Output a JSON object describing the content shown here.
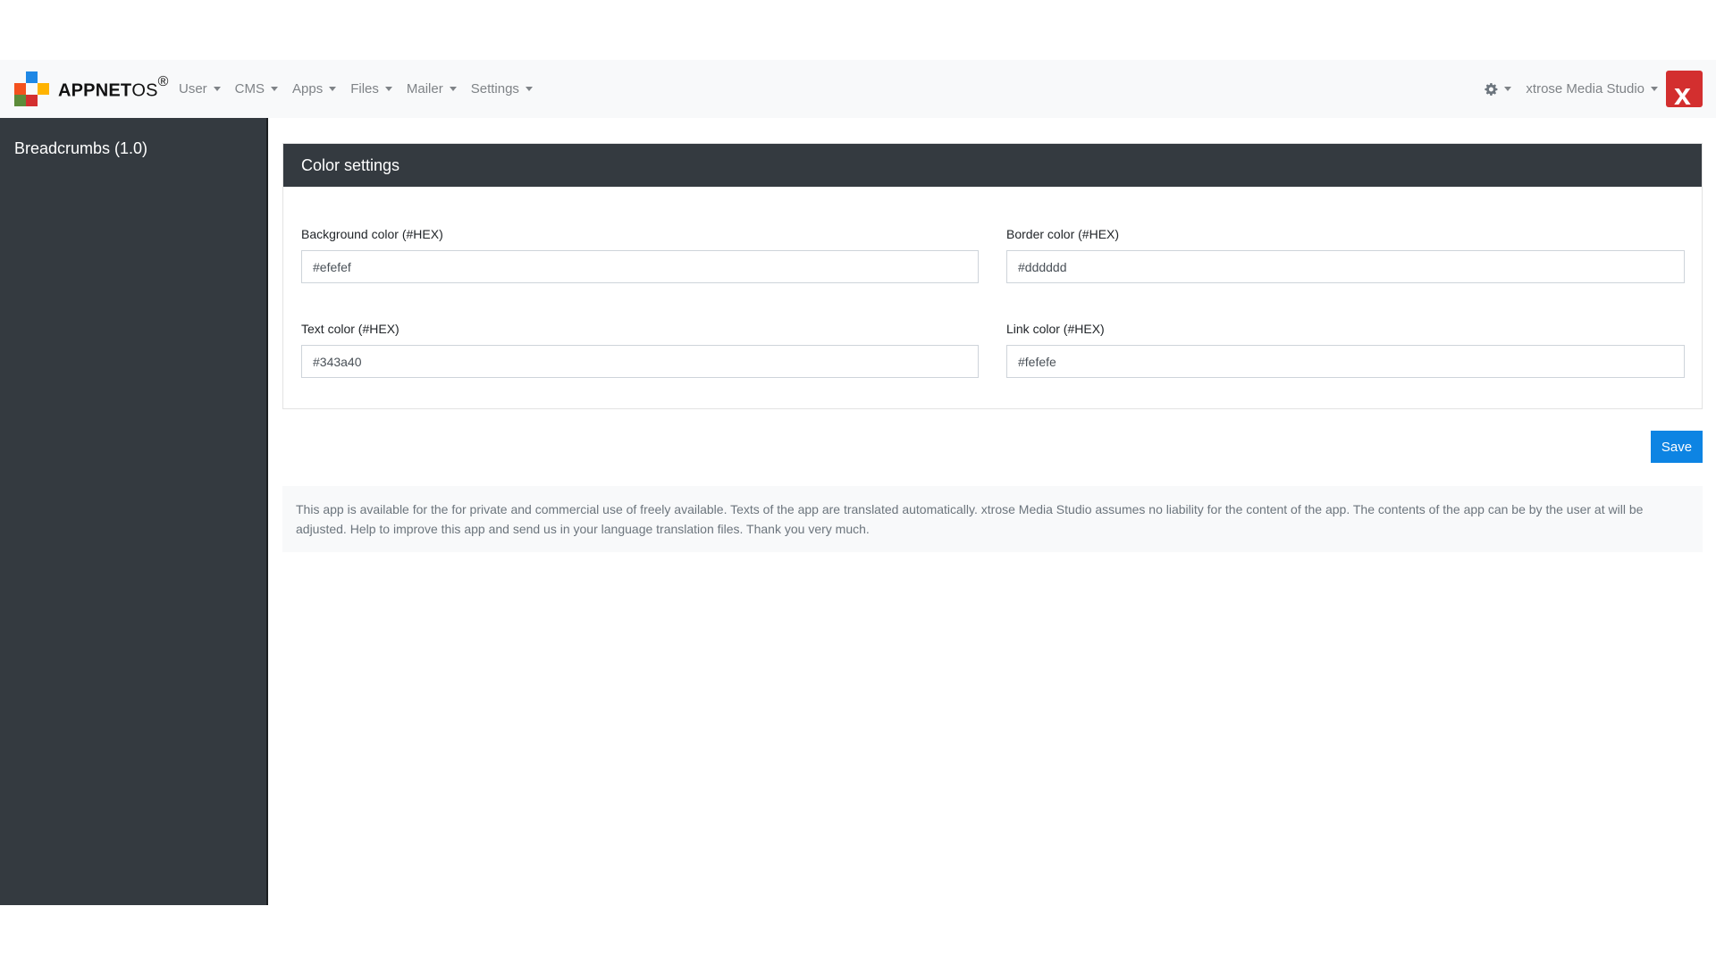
{
  "navbar": {
    "brand": {
      "bold": "APPNET",
      "light": "OS",
      "mark": "®"
    },
    "menu": [
      {
        "label": "User"
      },
      {
        "label": "CMS"
      },
      {
        "label": "Apps"
      },
      {
        "label": "Files"
      },
      {
        "label": "Mailer"
      },
      {
        "label": "Settings"
      }
    ],
    "settings_icon": "gear-icon",
    "user_label": "xtrose Media Studio",
    "vendor_logo_letter": "x"
  },
  "sidebar": {
    "title": "Breadcrumbs (1.0)"
  },
  "card": {
    "title": "Color settings",
    "fields": [
      {
        "label": "Background color (#HEX)",
        "value": "#efefef"
      },
      {
        "label": "Border color (#HEX)",
        "value": "#dddddd"
      },
      {
        "label": "Text color (#HEX)",
        "value": "#343a40"
      },
      {
        "label": "Link color (#HEX)",
        "value": "#fefefe"
      }
    ]
  },
  "actions": {
    "save_label": "Save"
  },
  "info": {
    "text": "This app is available for the for private and commercial use of freely available. Texts of the app are translated automatically. xtrose Media Studio assumes no liability for the content of the app. The contents of the app can be by the user at will be adjusted. Help to improve this app and send us in your language translation files. Thank you very much."
  },
  "colors": {
    "navbar_bg": "#f8f9fa",
    "dark": "#343a40",
    "primary": "#0d84e3",
    "vendor_red": "#d32f2f"
  }
}
